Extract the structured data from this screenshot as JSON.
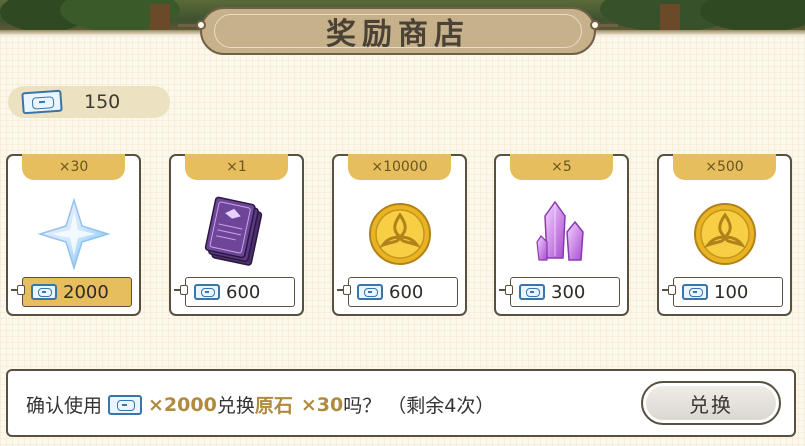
{
  "header": {
    "title": "奖励商店"
  },
  "currency": {
    "icon": "ticket-icon",
    "amount": "150"
  },
  "shop_items": [
    {
      "quantity": "×30",
      "icon": "primogem-icon",
      "price": "2000",
      "selected": true
    },
    {
      "quantity": "×1",
      "icon": "book-icon",
      "price": "600",
      "selected": false
    },
    {
      "quantity": "×10000",
      "icon": "mora-coin-icon",
      "price": "600",
      "selected": false
    },
    {
      "quantity": "×5",
      "icon": "crystal-icon",
      "price": "300",
      "selected": false
    },
    {
      "quantity": "×500",
      "icon": "mora-coin-icon",
      "price": "100",
      "selected": false
    }
  ],
  "confirm": {
    "prefix": "确认使用",
    "cost": "×2000",
    "exchange_word": "兑换",
    "item_name": "原石",
    "item_qty": "×30",
    "suffix": "吗？",
    "remaining": "（剩余4次）",
    "button_label": "兑换"
  },
  "colors": {
    "accent": "#e6be5d",
    "highlight_text": "#b08a3e",
    "border": "#585040",
    "background": "#fdf8ec"
  }
}
